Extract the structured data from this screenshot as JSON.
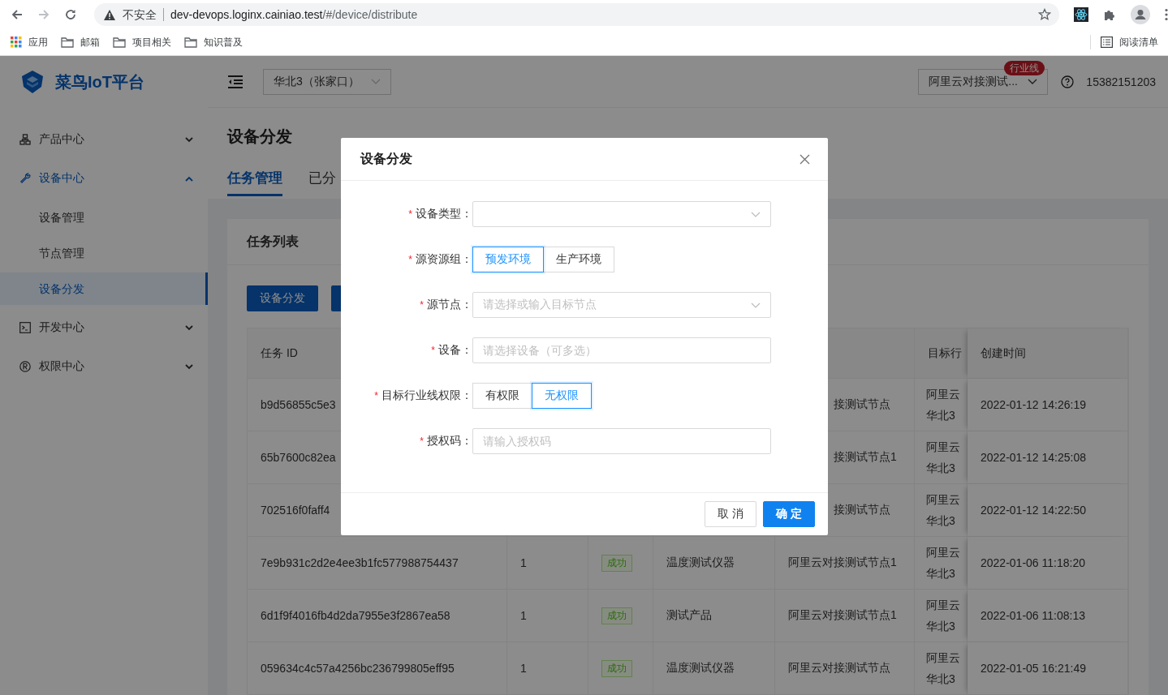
{
  "browser": {
    "security": "不安全",
    "url_host": "dev-devops.loginx.cainiao.test",
    "url_path": "/#/device/distribute",
    "bookmarks": [
      {
        "label": "应用",
        "kind": "apps"
      },
      {
        "label": "邮箱",
        "kind": "folder"
      },
      {
        "label": "项目相关",
        "kind": "folder"
      },
      {
        "label": "知识普及",
        "kind": "folder"
      }
    ],
    "reading_list": "阅读清单"
  },
  "header": {
    "logo": "菜鸟IoT平台",
    "region": "华北3（张家口）",
    "org_select": "阿里云对接测试...",
    "org_badge": "行业线",
    "user": "15382151203"
  },
  "sidebar": [
    {
      "label": "产品中心",
      "expanded": false
    },
    {
      "label": "设备中心",
      "expanded": true,
      "children": [
        {
          "label": "设备管理",
          "selected": false
        },
        {
          "label": "节点管理",
          "selected": false
        },
        {
          "label": "设备分发",
          "selected": true
        }
      ]
    },
    {
      "label": "开发中心",
      "expanded": false
    },
    {
      "label": "权限中心",
      "expanded": false
    }
  ],
  "page": {
    "title": "设备分发",
    "tabs": [
      {
        "label": "任务管理",
        "selected": true
      },
      {
        "label": "已分",
        "selected": false
      }
    ],
    "card_title": "任务列表",
    "primary_button": "设备分发"
  },
  "table": {
    "columns": {
      "column_1": "任务 ID",
      "column_6": "目标行",
      "column_7": "创建时间"
    },
    "rows": [
      {
        "covered": true,
        "task_id": "b9d56855c5e3",
        "node": "接测试节点",
        "target_line": [
          "阿里云",
          "华北3"
        ],
        "created": "2022-01-12 14:26:19"
      },
      {
        "covered": true,
        "task_id": "65b7600c82ea",
        "node": "接测试节点1",
        "target_line": [
          "阿里云",
          "华北3"
        ],
        "created": "2022-01-12 14:25:08"
      },
      {
        "covered": true,
        "task_id": "702516f0faff4",
        "node": "接测试节点",
        "target_line": [
          "阿里云",
          "华北3"
        ],
        "created": "2022-01-12 14:22:50"
      },
      {
        "covered": false,
        "task_id": "7e9b931c2d2e4ee3b1fc577988754437",
        "count": "1",
        "status": "成功",
        "product": "温度测试仪器",
        "node": "阿里云对接测试节点1",
        "target_line": [
          "阿里云",
          "华北3"
        ],
        "created": "2022-01-06 11:18:20"
      },
      {
        "covered": false,
        "task_id": "6d1f9f4016fb4d2da7955e3f2867ea58",
        "count": "1",
        "status": "成功",
        "product": "测试产品",
        "node": "阿里云对接测试节点1",
        "target_line": [
          "阿里云",
          "华北3"
        ],
        "created": "2022-01-06 11:08:13"
      },
      {
        "covered": false,
        "task_id": "059634c4c57a4256bc236799805eff95",
        "count": "1",
        "status": "成功",
        "product": "温度测试仪器",
        "node": "阿里云对接测试节点",
        "target_line": [
          "阿里云",
          "华北3"
        ],
        "created": "2022-01-05 16:21:49"
      }
    ]
  },
  "modal": {
    "title": "设备分发",
    "fields": [
      {
        "required_mark": "*",
        "label": "设备类型：",
        "kind": "select"
      },
      {
        "required_mark": "*",
        "label": "源资源组：",
        "kind": "radio",
        "options": [
          {
            "label": "预发环境",
            "selected": true
          },
          {
            "label": "生产环境",
            "selected": false
          }
        ]
      },
      {
        "required_mark": "*",
        "label": "源节点：",
        "kind": "select",
        "placeholder": "请选择或输入目标节点"
      },
      {
        "required_mark": "*",
        "label": "设备：",
        "kind": "input",
        "placeholder": "请选择设备（可多选）"
      },
      {
        "required_mark": "*",
        "label": "目标行业线权限：",
        "kind": "radio",
        "options": [
          {
            "label": "有权限",
            "selected": false
          },
          {
            "label": "无权限",
            "selected": true
          }
        ]
      },
      {
        "required_mark": "*",
        "label": "授权码：",
        "kind": "input",
        "placeholder": "请输入授权码"
      }
    ],
    "buttons": [
      {
        "label": "取 消",
        "kind": "default"
      },
      {
        "label": "确 定",
        "kind": "primary"
      }
    ]
  }
}
